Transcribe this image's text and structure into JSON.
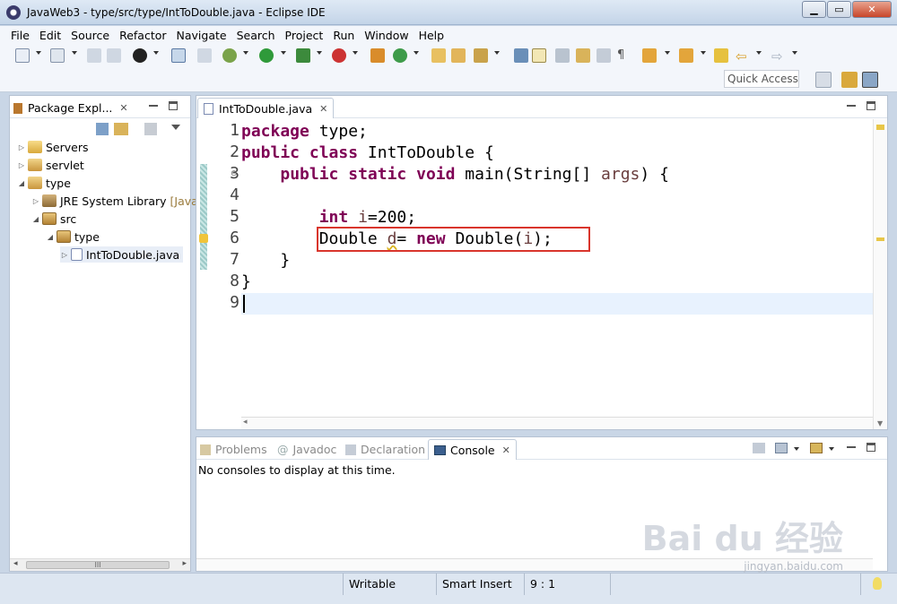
{
  "window": {
    "title": "JavaWeb3 - type/src/type/IntToDouble.java - Eclipse IDE"
  },
  "menu": [
    "File",
    "Edit",
    "Source",
    "Refactor",
    "Navigate",
    "Search",
    "Project",
    "Run",
    "Window",
    "Help"
  ],
  "toolbar": {
    "quick_access": "Quick Access"
  },
  "explorer": {
    "tab_label": "Package Expl...",
    "tree": [
      {
        "label": "Servers",
        "suffix": ""
      },
      {
        "label": "servlet",
        "suffix": ""
      },
      {
        "label": "type",
        "suffix": ""
      },
      {
        "label": "JRE System Library",
        "suffix": "[Java"
      },
      {
        "label": "src",
        "suffix": ""
      },
      {
        "label": "type",
        "suffix": ""
      },
      {
        "label": "IntToDouble.java",
        "suffix": ""
      }
    ],
    "scroll_thumb": "III"
  },
  "editor": {
    "tab_label": "IntToDouble.java",
    "line_numbers": [
      "1",
      "2",
      "3",
      "4",
      "5",
      "6",
      "7",
      "8",
      "9"
    ],
    "lines": {
      "l1_kw": "package",
      "l1_rest": " type;",
      "l2_kw1": "public",
      "l2_kw2": "class",
      "l2_rest": " IntToDouble {",
      "l3_kw1": "public",
      "l3_kw2": "static",
      "l3_kw3": "void",
      "l3_a": " main(String[] ",
      "l3_param": "args",
      "l3_b": ") {",
      "l5_kw": "int",
      "l5_var": "i",
      "l5_rest": "=200;",
      "l6_a": "Double ",
      "l6_var": "d",
      "l6_b": "= ",
      "l6_kw": "new",
      "l6_c": " Double(",
      "l6_arg": "i",
      "l6_d": ");",
      "l7": "}",
      "l8": "}"
    }
  },
  "bottom": {
    "tabs": [
      "Problems",
      "Javadoc",
      "Declaration",
      "Console"
    ],
    "console_message": "No consoles to display at this time."
  },
  "status": {
    "writable": "Writable",
    "insert_mode": "Smart Insert",
    "position": "9 : 1"
  },
  "watermark": {
    "brand": "Bai du 经验",
    "url": "jingyan.baidu.com"
  }
}
